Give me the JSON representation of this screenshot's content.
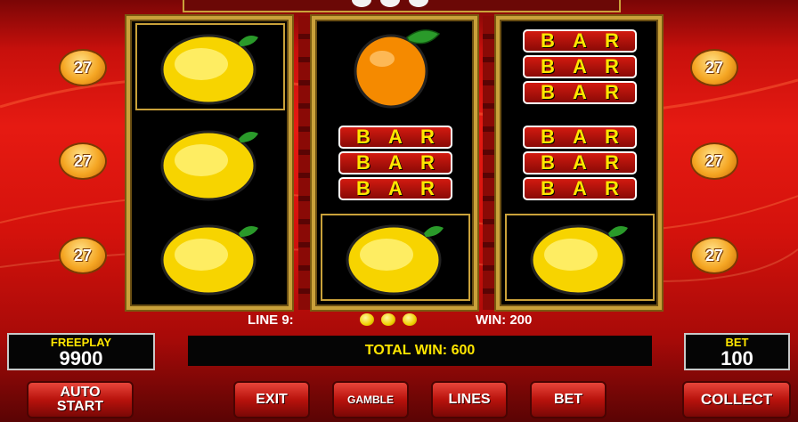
{
  "reels": {
    "columns": [
      {
        "symbols": [
          "lemon",
          "lemon",
          "lemon"
        ]
      },
      {
        "symbols": [
          "orange",
          "bar-triple",
          "lemon"
        ]
      },
      {
        "symbols": [
          "bar-triple",
          "bar-triple",
          "lemon"
        ]
      }
    ],
    "bar_text": [
      "B",
      "A",
      "R"
    ]
  },
  "line_badges": {
    "left": [
      "27",
      "27",
      "27"
    ],
    "right": [
      "27",
      "27",
      "27"
    ]
  },
  "info": {
    "line_label": "LINE 9:",
    "win_label": "WIN: 200",
    "line_symbol_count": 3
  },
  "freeplay": {
    "label": "FREEPLAY",
    "value": "9900"
  },
  "bet_panel": {
    "label": "BET",
    "value": "100"
  },
  "total_win": "TOTAL WIN: 600",
  "buttons": {
    "auto_start_1": "AUTO",
    "auto_start_2": "START",
    "exit": "EXIT",
    "gamble": "GAMBLE",
    "lines": "LINES",
    "bet": "BET",
    "collect": "COLLECT"
  },
  "colors": {
    "background_red": "#e61a12",
    "gold_frame": "#c9a13a",
    "highlight_yellow": "#ffe600"
  }
}
